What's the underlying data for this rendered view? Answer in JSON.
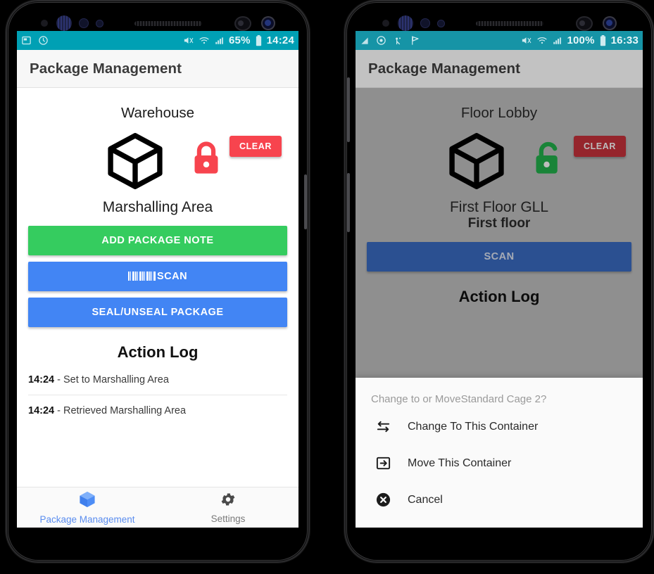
{
  "phone_left": {
    "status_bar": {
      "left_icons": [
        "sim-card-icon",
        "clock-icon"
      ],
      "mute_icon": "mute-icon",
      "wifi_icon": "wifi-icon",
      "signal_icon": "signal-icon",
      "battery_percent": "65%",
      "battery_icon": "battery-icon",
      "time": "14:24",
      "background": "#00A0B4"
    },
    "toolbar": {
      "title": "Package Management"
    },
    "hero": {
      "top_label": "Warehouse",
      "box_icon": "package-box-icon",
      "lock_icon": "locked-padlock-icon",
      "lock_color": "#F7444E",
      "clear_label": "CLEAR",
      "name": "Marshalling Area",
      "sub": ""
    },
    "buttons": [
      {
        "label": "ADD PACKAGE NOTE",
        "color": "#35CC5F",
        "icon": ""
      },
      {
        "label": "SCAN",
        "color": "#4285F4",
        "icon": "barcode-icon"
      },
      {
        "label": "SEAL/UNSEAL PACKAGE",
        "color": "#4285F4",
        "icon": ""
      }
    ],
    "log": {
      "title": "Action Log",
      "rows": [
        {
          "time": "14:24",
          "text": " - Set to Marshalling Area"
        },
        {
          "time": "14:24",
          "text": " - Retrieved Marshalling Area"
        }
      ]
    },
    "bottom_nav": [
      {
        "label": "Package Management",
        "icon": "package-box-icon",
        "active": true
      },
      {
        "label": "Settings",
        "icon": "gear-icon",
        "active": false
      }
    ]
  },
  "phone_right": {
    "status_bar": {
      "left_icons": [
        "sim-card-icon",
        "clock-icon",
        "location-icon",
        "flag-icon"
      ],
      "mute_icon": "mute-icon",
      "wifi_icon": "wifi-icon",
      "signal_icon": "signal-icon",
      "battery_percent": "100%",
      "battery_icon": "battery-icon",
      "time": "16:33",
      "background": "#00A0B4"
    },
    "toolbar": {
      "title": "Package Management"
    },
    "hero": {
      "top_label": "Floor Lobby",
      "box_icon": "package-box-icon",
      "lock_icon": "unlocked-padlock-icon",
      "lock_color": "#22B24C",
      "clear_label": "CLEAR",
      "name": "First Floor GLL",
      "sub": "First floor"
    },
    "buttons": [
      {
        "label": "SCAN",
        "color": "#3A6DC4",
        "icon": ""
      }
    ],
    "log": {
      "title": "Action Log",
      "rows": []
    },
    "sheet": {
      "title": "Change to or MoveStandard Cage 2?",
      "items": [
        {
          "label": "Change To This Container",
          "icon": "swap-arrows-icon"
        },
        {
          "label": "Move This Container",
          "icon": "move-into-box-icon"
        },
        {
          "label": "Cancel",
          "icon": "cancel-circle-x-icon"
        }
      ]
    }
  }
}
